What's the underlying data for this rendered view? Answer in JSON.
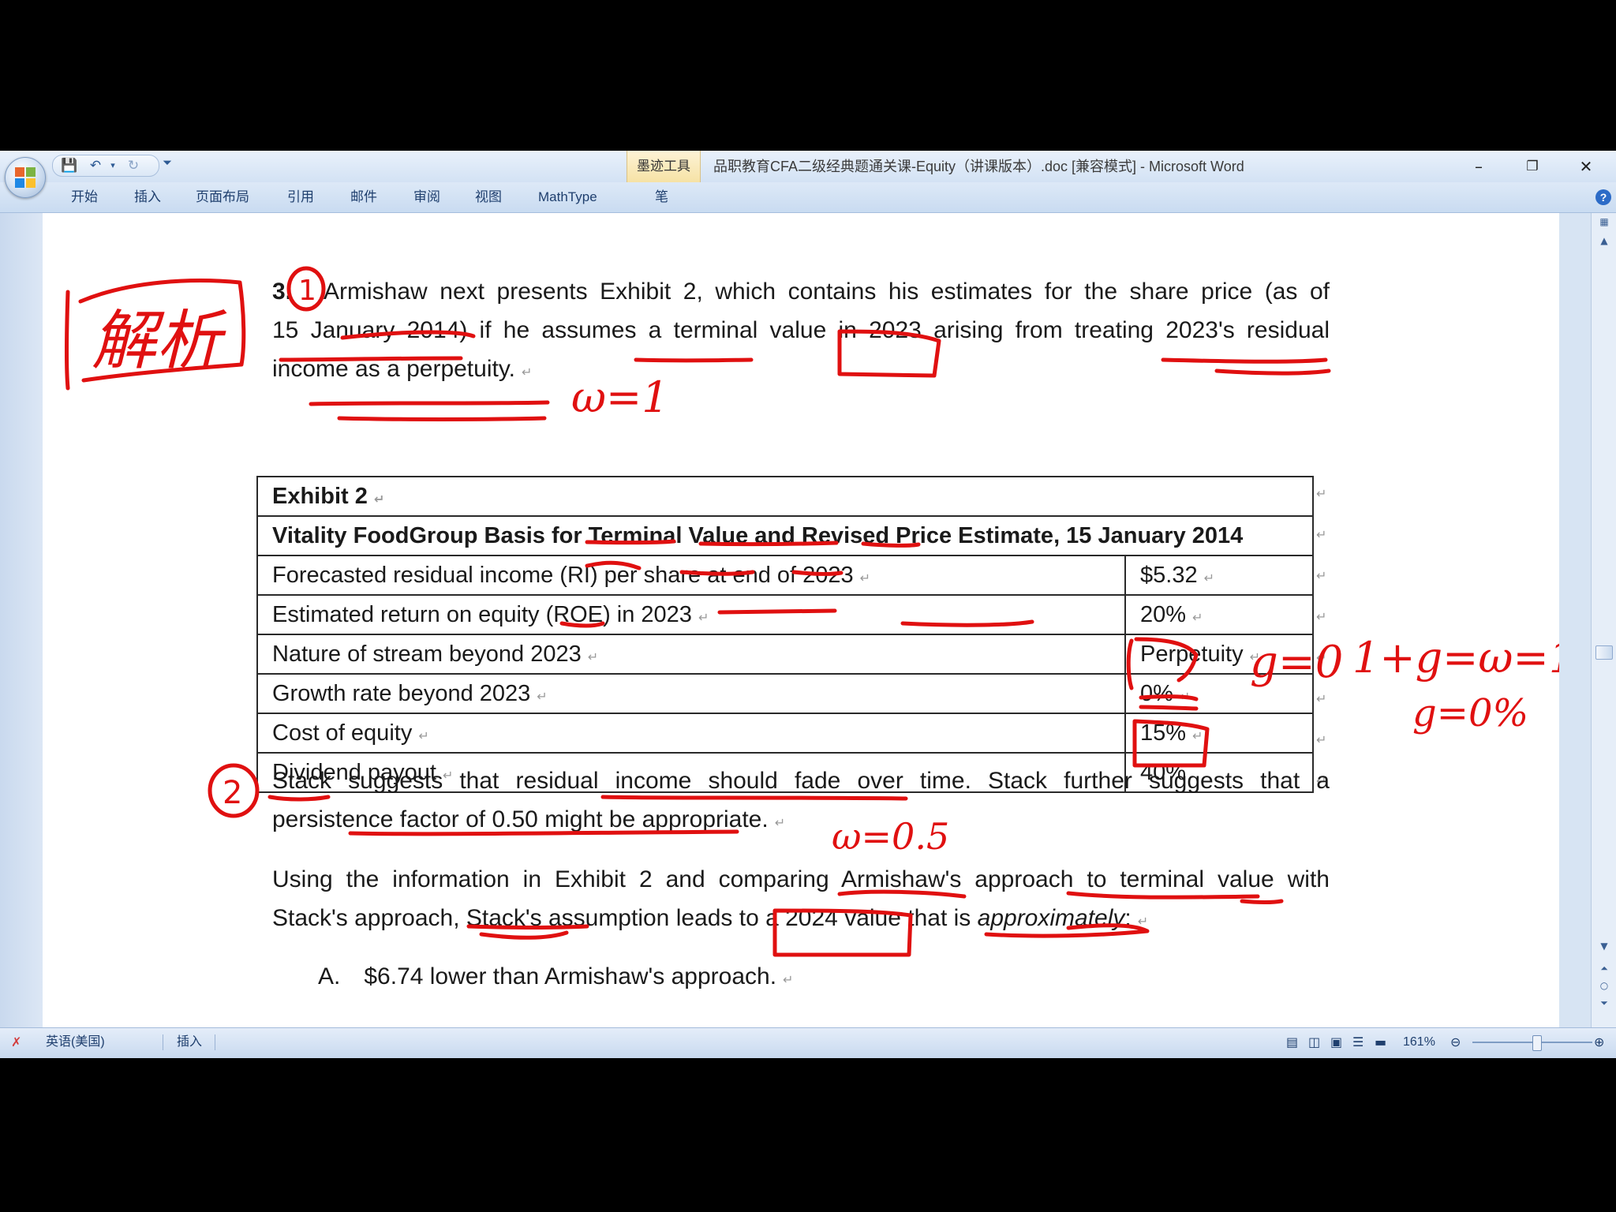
{
  "window": {
    "title": "品职教育CFA二级经典题通关课-Equity（讲课版本）.doc [兼容模式] - Microsoft Word",
    "contextual_tab_group": "墨迹工具",
    "tabs": [
      "开始",
      "插入",
      "页面布局",
      "引用",
      "邮件",
      "审阅",
      "视图",
      "MathType",
      "笔"
    ]
  },
  "question": {
    "number": "3.",
    "para1": [
      "Armishaw next presents Exhibit 2, which contains his estimates for the share price (as of",
      "15 January 2014) if he assumes a terminal value in 2023 arising from treating 2023's residual",
      "income as a perpetuity."
    ],
    "exhibit_title": "Exhibit 2",
    "exhibit_subtitle": "Vitality FoodGroup Basis for Terminal Value and Revised Price Estimate, 15 January 2014",
    "rows": [
      {
        "label": "Forecasted residual income (RI) per share at end of 2023",
        "value": "$5.32"
      },
      {
        "label": "Estimated return on equity (ROE) in 2023",
        "value": "20%"
      },
      {
        "label": "Nature of stream beyond 2023",
        "value": "Perpetuity"
      },
      {
        "label": "Growth rate beyond 2023",
        "value": "0%"
      },
      {
        "label": "Cost of equity",
        "value": "15%"
      },
      {
        "label": "Dividend payout",
        "value": "40%"
      }
    ],
    "para2": [
      "Stack suggests that residual income should fade over time. Stack further suggests that a",
      "persistence factor of 0.50 might be appropriate."
    ],
    "para3_line1": "Using the information in Exhibit 2 and comparing Armishaw's approach to terminal value with",
    "para3_line2_a": "Stack's approach, Stack's assumption leads to a 2024 value that is ",
    "para3_line2_em": "approximately",
    "para3_line2_b": ":",
    "option_a_letter": "A.",
    "option_a_text": "$6.74 lower than Armishaw's approach."
  },
  "annotations": {
    "side_note": "解析",
    "circle_1": "1",
    "circle_2": "2",
    "w1": "ω=1",
    "g0": "g=0",
    "eq": "1+g=ω=1",
    "g0pct": "g=0%",
    "w05": "ω=0.5"
  },
  "statusbar": {
    "language": "英语(美国)",
    "mode": "插入",
    "zoom": "161%"
  },
  "colors": {
    "ink": "#e01010",
    "chrome": "#cfdff3"
  }
}
